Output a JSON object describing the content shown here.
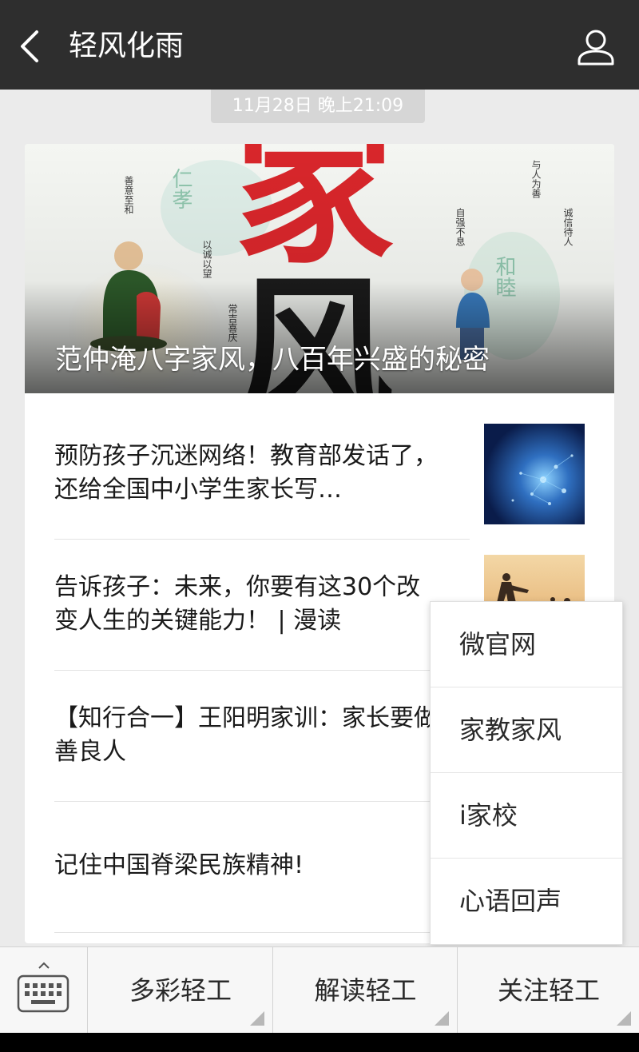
{
  "header": {
    "title": "轻风化雨"
  },
  "timestamp": "11月28日 晚上21:09",
  "card": {
    "cover": {
      "title": "范仲淹八字家风，八百年兴盛的秘密",
      "image_text": "家风"
    },
    "items": [
      {
        "title": "预防孩子沉迷网络！教育部发话了，还给全国中小学生家长写…"
      },
      {
        "title": "告诉孩子：未来，你要有这30个改变人生的关键能力！ | 漫读"
      },
      {
        "title": "【知行合一】王阳明家训：家长要做善良人"
      },
      {
        "title": "记住中国脊梁民族精神!"
      }
    ]
  },
  "popup_menu": {
    "items": [
      "微官网",
      "家教家风",
      "i家校",
      "心语回声"
    ]
  },
  "bottom_menu": {
    "items": [
      "多彩轻工",
      "解读轻工",
      "关注轻工"
    ]
  },
  "colors": {
    "topbar": "#2e2e2e",
    "background": "#ebebeb",
    "timestamp_pill": "#d6d6d6",
    "cover_red": "#d8262b"
  },
  "icons": {
    "back": "chevron-left-icon",
    "profile": "user-icon",
    "keyboard": "keyboard-icon"
  }
}
